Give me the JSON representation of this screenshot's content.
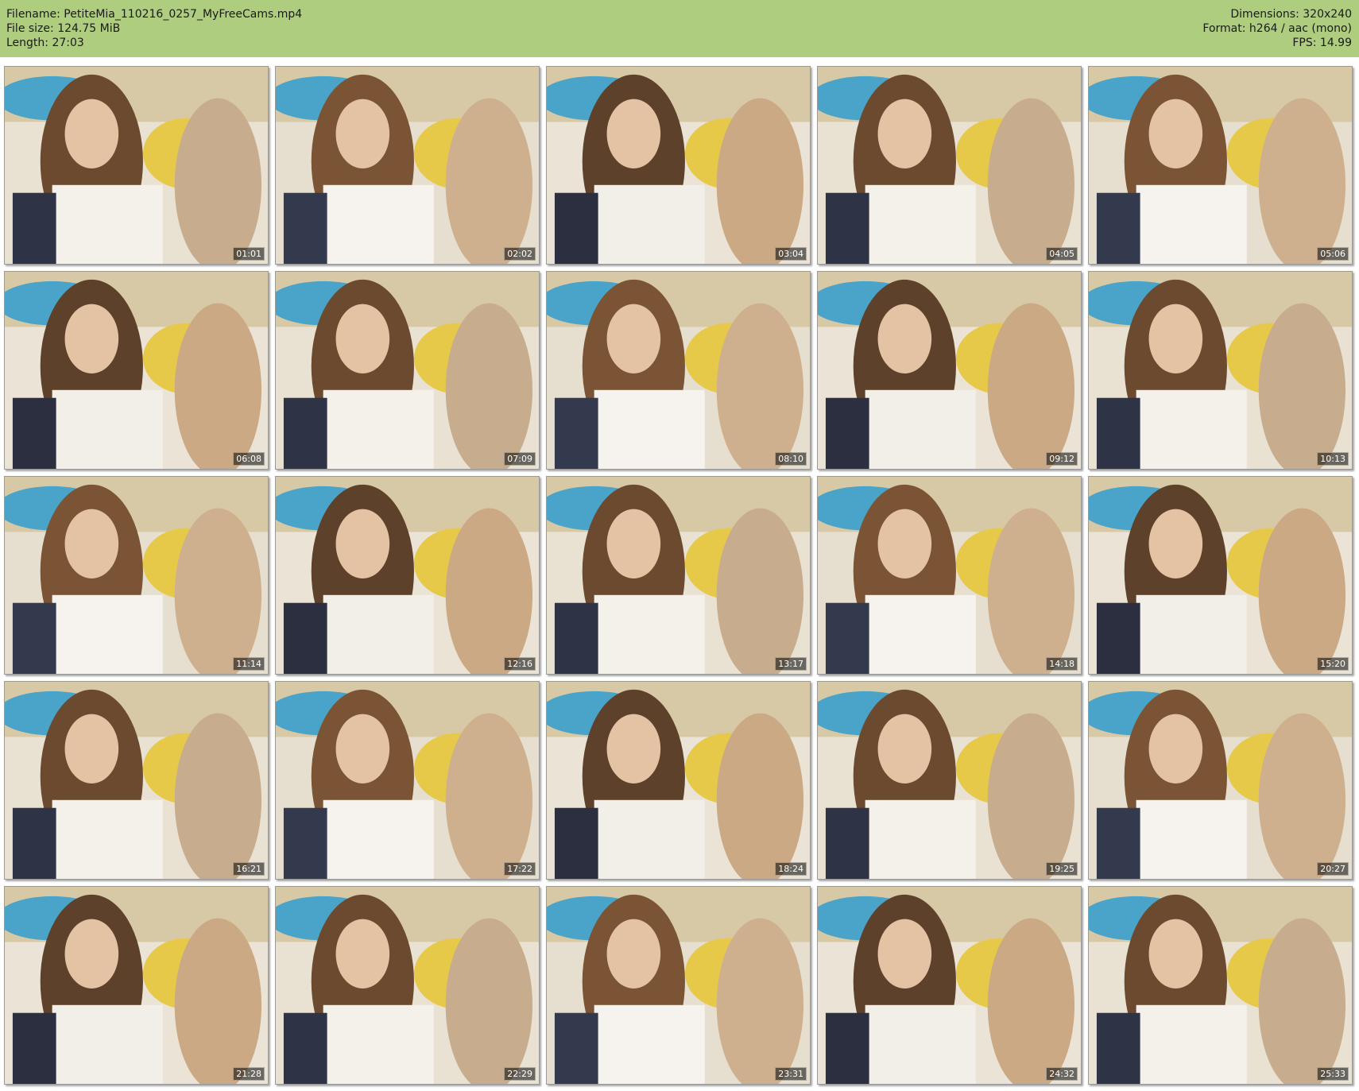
{
  "header": {
    "left": [
      "Filename: PetiteMia_110216_0257_MyFreeCams.mp4",
      "File size: 124.75 MiB",
      "Length: 27:03"
    ],
    "right": [
      "Dimensions: 320x240",
      "Format: h264 / aac (mono)",
      "FPS: 14.99"
    ],
    "background_color": "#afcd7f"
  },
  "thumbnails": [
    {
      "timestamp": "01:01"
    },
    {
      "timestamp": "02:02"
    },
    {
      "timestamp": "03:04"
    },
    {
      "timestamp": "04:05"
    },
    {
      "timestamp": "05:06"
    },
    {
      "timestamp": "06:08"
    },
    {
      "timestamp": "07:09"
    },
    {
      "timestamp": "08:10"
    },
    {
      "timestamp": "09:12"
    },
    {
      "timestamp": "10:13"
    },
    {
      "timestamp": "11:14"
    },
    {
      "timestamp": "12:16"
    },
    {
      "timestamp": "13:17"
    },
    {
      "timestamp": "14:18"
    },
    {
      "timestamp": "15:20"
    },
    {
      "timestamp": "16:21"
    },
    {
      "timestamp": "17:22"
    },
    {
      "timestamp": "18:24"
    },
    {
      "timestamp": "19:25"
    },
    {
      "timestamp": "20:27"
    },
    {
      "timestamp": "21:28"
    },
    {
      "timestamp": "22:29"
    },
    {
      "timestamp": "23:31"
    },
    {
      "timestamp": "24:32"
    },
    {
      "timestamp": "25:33"
    }
  ]
}
